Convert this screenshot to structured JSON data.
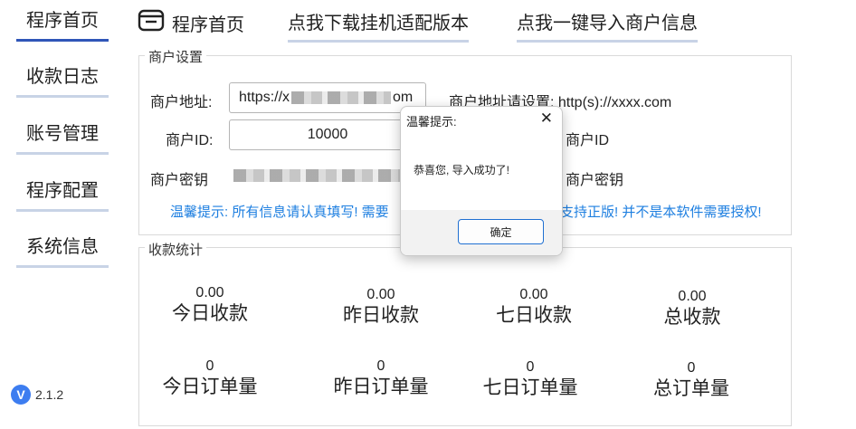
{
  "sidebar": {
    "items": [
      {
        "label": "程序首页"
      },
      {
        "label": "收款日志"
      },
      {
        "label": "账号管理"
      },
      {
        "label": "程序配置"
      },
      {
        "label": "系统信息"
      }
    ],
    "version": {
      "badge": "V",
      "number": "2.1.2"
    }
  },
  "topbar": {
    "title": "程序首页",
    "links": [
      "点我下载挂机适配版本",
      "点我一键导入商户信息"
    ]
  },
  "merchant": {
    "group_title": "商户设置",
    "address_label": "商户地址:",
    "address_value_start": "https://x",
    "address_value_end": "om",
    "address_hint": "商户地址请设置: http(s)://xxxx.com",
    "id_label": "商户ID:",
    "id_value": "10000",
    "id_hint": "商户ID",
    "key_label": "商户密钥",
    "key_hint": "商户密钥",
    "tip_left": "温馨提示: 所有信息请认真填写! 需要",
    "tip_right": "支持正版! 并不是本软件需要授权!"
  },
  "stats": {
    "group_title": "收款统计",
    "items": [
      {
        "value": "0.00",
        "label": "今日收款"
      },
      {
        "value": "0.00",
        "label": "昨日收款"
      },
      {
        "value": "0.00",
        "label": "七日收款"
      },
      {
        "value": "0.00",
        "label": "总收款"
      },
      {
        "value": "0",
        "label": "今日订单量"
      },
      {
        "value": "0",
        "label": "昨日订单量"
      },
      {
        "value": "0",
        "label": "七日订单量"
      },
      {
        "value": "0",
        "label": "总订单量"
      }
    ]
  },
  "dialog": {
    "title": "温馨提示:",
    "message": "恭喜您, 导入成功了!",
    "ok_label": "确定"
  },
  "colors": {
    "accent": "#2f56b8",
    "underline": "#c8d3e6",
    "hint": "#1e7fe0",
    "button_border": "#1f6fd1"
  }
}
